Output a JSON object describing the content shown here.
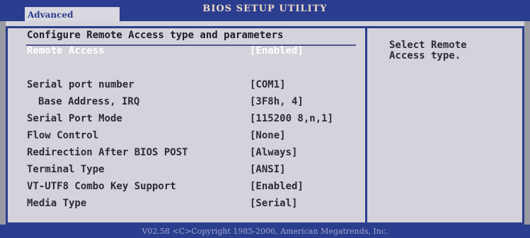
{
  "header": {
    "title": "BIOS SETUP UTILITY",
    "active_tab": "Advanced"
  },
  "section_heading": "Configure Remote Access type and parameters",
  "settings": [
    {
      "label": "Remote Access",
      "value": "[Enabled]",
      "selected": true
    },
    {
      "label": "Serial port number",
      "value": "[COM1]"
    },
    {
      "label": "Base Address, IRQ",
      "value": "[3F8h, 4]",
      "indent": true
    },
    {
      "label": "Serial Port Mode",
      "value": "[115200 8,n,1]"
    },
    {
      "label": "Flow Control",
      "value": "[None]"
    },
    {
      "label": "Redirection After BIOS POST",
      "value": "[Always]"
    },
    {
      "label": "Terminal Type",
      "value": "[ANSI]"
    },
    {
      "label": "VT-UTF8 Combo Key Support",
      "value": "[Enabled]"
    },
    {
      "label": "Media Type",
      "value": "[Serial]"
    }
  ],
  "help_text": "Select Remote\nAccess type.",
  "footer": "V02.58 <C>Copyright 1985-2006, American Megatrends, Inc.",
  "colors": {
    "frame": "#2b3d8e",
    "panel": "#d4d2da",
    "text": "#2c2c3a",
    "selected_text": "#ffffff"
  }
}
